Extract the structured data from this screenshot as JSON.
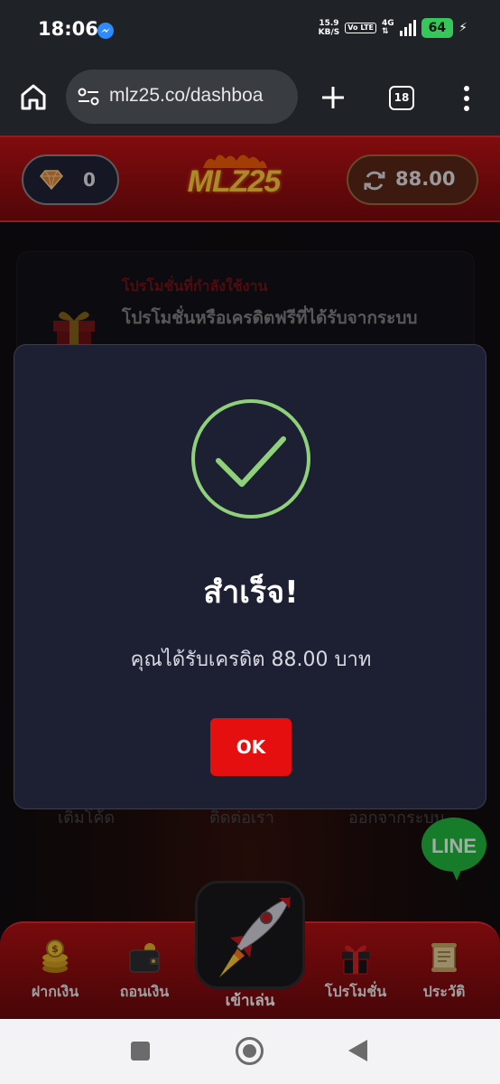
{
  "status_bar": {
    "time": "18:06",
    "net_speed_value": "15.9",
    "net_speed_unit": "KB/S",
    "volte": "Vo LTE",
    "network": "4G",
    "battery": "64"
  },
  "browser": {
    "url": "mlz25.co/dashboa",
    "tab_count": "18"
  },
  "header": {
    "gem_count": "0",
    "logo": "MLZ25",
    "credit": "88.00"
  },
  "promo": {
    "active_label": "โปรโมชั่นที่กำลังใช้งาน",
    "description": "โปรโมชั่นหรือเครดิตฟรีที่ได้รับจากระบบ"
  },
  "menu_labels": [
    "เติมโค้ด",
    "ติดต่อเรา",
    "ออกจากระบบ"
  ],
  "line_button": "LINE",
  "bottom_nav": {
    "deposit": "ฝากเงิน",
    "withdraw": "ถอนเงิน",
    "play": "เข้าเล่น",
    "promotions": "โปรโมชั่น",
    "history": "ประวัติ"
  },
  "modal": {
    "title": "สำเร็จ!",
    "message": "คุณได้รับเครดิต 88.00 บาท",
    "ok_label": "OK",
    "icon": "check-circle-icon",
    "accent_color": "#8fd07a"
  },
  "colors": {
    "primary_red": "#e50f0f",
    "modal_bg": "#1d2033"
  }
}
